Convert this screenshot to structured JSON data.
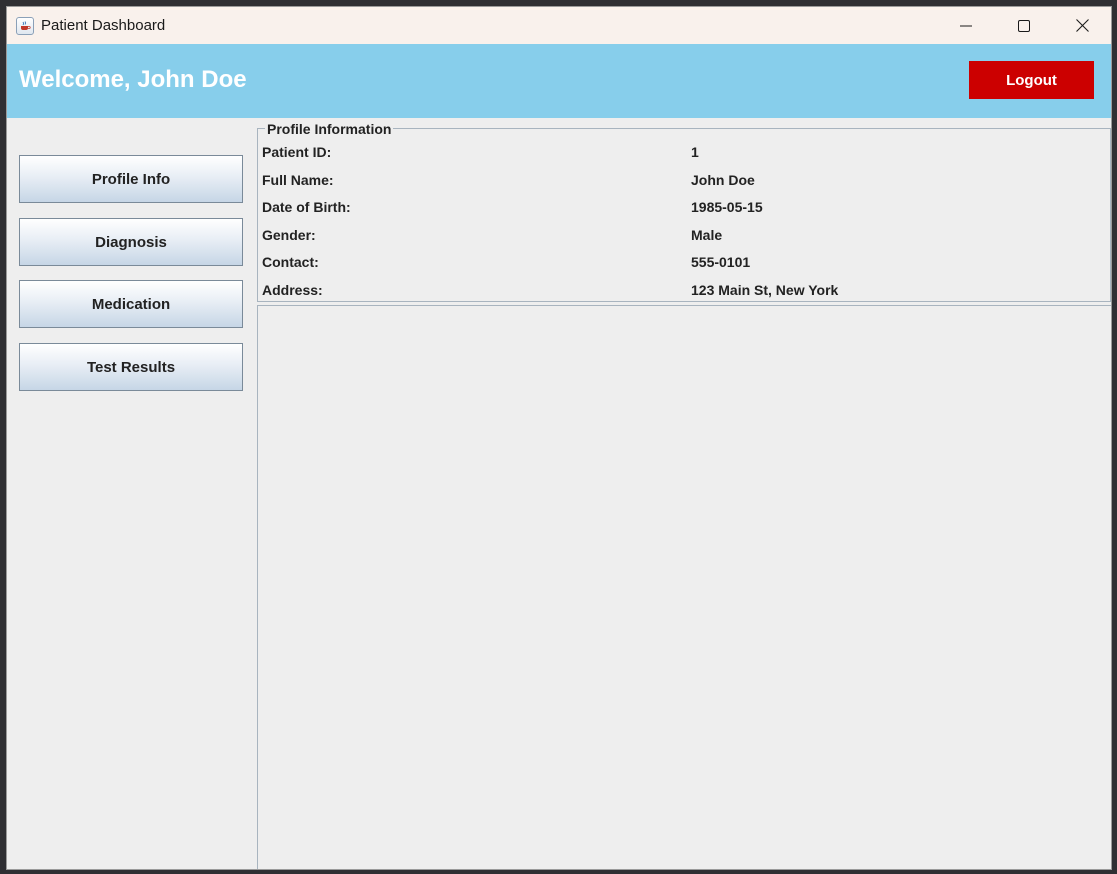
{
  "window": {
    "title": "Patient Dashboard"
  },
  "header": {
    "welcome": "Welcome, John Doe",
    "logout_label": "Logout",
    "background_color": "#87ceeb",
    "logout_color": "#cc0000"
  },
  "sidebar": {
    "items": [
      {
        "label": "Profile Info"
      },
      {
        "label": "Diagnosis"
      },
      {
        "label": "Medication"
      },
      {
        "label": "Test Results"
      }
    ]
  },
  "profile": {
    "legend": "Profile Information",
    "rows": [
      {
        "label": "Patient ID:",
        "value": "1"
      },
      {
        "label": "Full Name:",
        "value": "John Doe"
      },
      {
        "label": "Date of Birth:",
        "value": "1985-05-15"
      },
      {
        "label": "Gender:",
        "value": "Male"
      },
      {
        "label": "Contact:",
        "value": "555-0101"
      },
      {
        "label": "Address:",
        "value": "123 Main St, New York"
      }
    ]
  },
  "icons": {
    "app": "java-cup-icon",
    "minimize": "minimize-icon",
    "maximize": "maximize-icon",
    "close": "close-icon"
  }
}
